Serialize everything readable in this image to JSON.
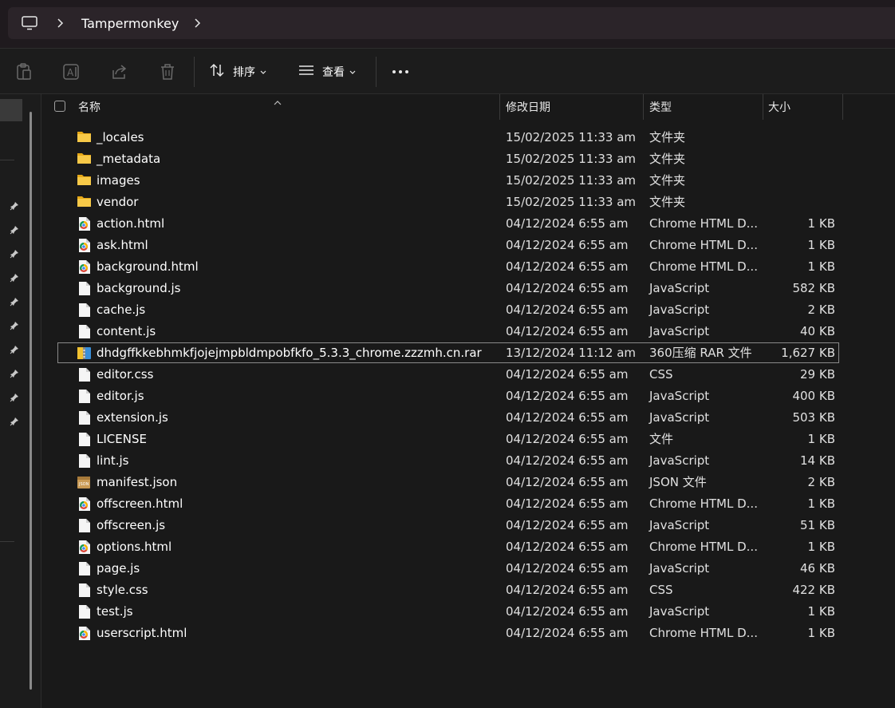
{
  "address": {
    "breadcrumb": "Tampermonkey",
    "pc_icon": "computer-icon"
  },
  "toolbar": {
    "sort_label": "排序",
    "view_label": "查看",
    "more_icon": "more-icon"
  },
  "columns": {
    "name": "名称",
    "date": "修改日期",
    "type": "类型",
    "size": "大小"
  },
  "files": [
    {
      "name": "_locales",
      "date": "15/02/2025 11:33 am",
      "type": "文件夹",
      "size": "",
      "kind": "folder"
    },
    {
      "name": "_metadata",
      "date": "15/02/2025 11:33 am",
      "type": "文件夹",
      "size": "",
      "kind": "folder"
    },
    {
      "name": "images",
      "date": "15/02/2025 11:33 am",
      "type": "文件夹",
      "size": "",
      "kind": "folder"
    },
    {
      "name": "vendor",
      "date": "15/02/2025 11:33 am",
      "type": "文件夹",
      "size": "",
      "kind": "folder"
    },
    {
      "name": "action.html",
      "date": "04/12/2024 6:55 am",
      "type": "Chrome HTML D...",
      "size": "1 KB",
      "kind": "chrome"
    },
    {
      "name": "ask.html",
      "date": "04/12/2024 6:55 am",
      "type": "Chrome HTML D...",
      "size": "1 KB",
      "kind": "chrome"
    },
    {
      "name": "background.html",
      "date": "04/12/2024 6:55 am",
      "type": "Chrome HTML D...",
      "size": "1 KB",
      "kind": "chrome"
    },
    {
      "name": "background.js",
      "date": "04/12/2024 6:55 am",
      "type": "JavaScript",
      "size": "582 KB",
      "kind": "file"
    },
    {
      "name": "cache.js",
      "date": "04/12/2024 6:55 am",
      "type": "JavaScript",
      "size": "2 KB",
      "kind": "file"
    },
    {
      "name": "content.js",
      "date": "04/12/2024 6:55 am",
      "type": "JavaScript",
      "size": "40 KB",
      "kind": "file"
    },
    {
      "name": "dhdgffkkebhmkfjojejmpbldmpobfkfo_5.3.3_chrome.zzzmh.cn.rar",
      "date": "13/12/2024 11:12 am",
      "type": "360压缩 RAR 文件",
      "size": "1,627 KB",
      "kind": "rar",
      "selected": true
    },
    {
      "name": "editor.css",
      "date": "04/12/2024 6:55 am",
      "type": "CSS",
      "size": "29 KB",
      "kind": "file"
    },
    {
      "name": "editor.js",
      "date": "04/12/2024 6:55 am",
      "type": "JavaScript",
      "size": "400 KB",
      "kind": "file"
    },
    {
      "name": "extension.js",
      "date": "04/12/2024 6:55 am",
      "type": "JavaScript",
      "size": "503 KB",
      "kind": "file"
    },
    {
      "name": "LICENSE",
      "date": "04/12/2024 6:55 am",
      "type": "文件",
      "size": "1 KB",
      "kind": "file"
    },
    {
      "name": "lint.js",
      "date": "04/12/2024 6:55 am",
      "type": "JavaScript",
      "size": "14 KB",
      "kind": "file"
    },
    {
      "name": "manifest.json",
      "date": "04/12/2024 6:55 am",
      "type": "JSON 文件",
      "size": "2 KB",
      "kind": "json"
    },
    {
      "name": "offscreen.html",
      "date": "04/12/2024 6:55 am",
      "type": "Chrome HTML D...",
      "size": "1 KB",
      "kind": "chrome"
    },
    {
      "name": "offscreen.js",
      "date": "04/12/2024 6:55 am",
      "type": "JavaScript",
      "size": "51 KB",
      "kind": "file"
    },
    {
      "name": "options.html",
      "date": "04/12/2024 6:55 am",
      "type": "Chrome HTML D...",
      "size": "1 KB",
      "kind": "chrome"
    },
    {
      "name": "page.js",
      "date": "04/12/2024 6:55 am",
      "type": "JavaScript",
      "size": "46 KB",
      "kind": "file"
    },
    {
      "name": "style.css",
      "date": "04/12/2024 6:55 am",
      "type": "CSS",
      "size": "422 KB",
      "kind": "file"
    },
    {
      "name": "test.js",
      "date": "04/12/2024 6:55 am",
      "type": "JavaScript",
      "size": "1 KB",
      "kind": "file"
    },
    {
      "name": "userscript.html",
      "date": "04/12/2024 6:55 am",
      "type": "Chrome HTML D...",
      "size": "1 KB",
      "kind": "chrome"
    }
  ],
  "colors": {
    "folder": "#f7c948",
    "selection_border": "#8a8a8a",
    "background": "#191919"
  }
}
